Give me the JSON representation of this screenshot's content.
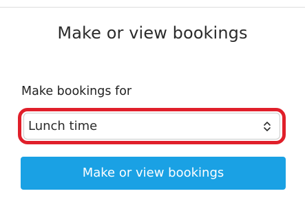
{
  "page": {
    "title": "Make or view bookings"
  },
  "booking_form": {
    "label": "Make bookings for",
    "select": {
      "selected_value": "Lunch time",
      "icon": "chevron-up-down-icon"
    },
    "submit_label": "Make or view bookings"
  },
  "colors": {
    "primary_button": "#1aa1e4",
    "highlight_ring": "#e01f2a"
  }
}
